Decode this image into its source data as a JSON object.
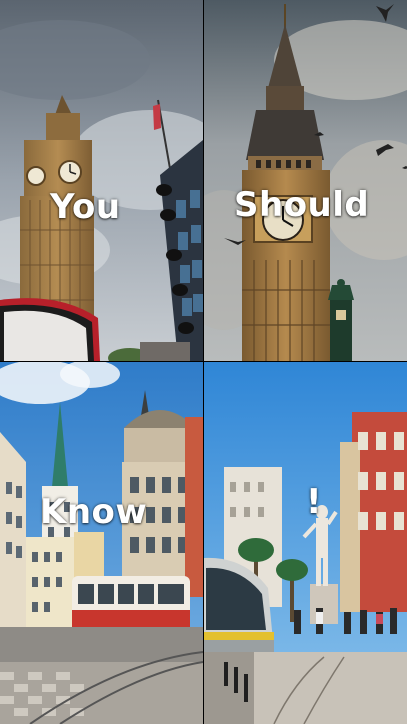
{
  "captions": {
    "word1": "You",
    "word2": "Should",
    "word3": "Know",
    "word4": "!"
  },
  "colors": {
    "stone": "#b08a55",
    "clock_face": "#f3eedf",
    "tram_red": "#c8362d",
    "sky_blue": "#3a86d6"
  }
}
